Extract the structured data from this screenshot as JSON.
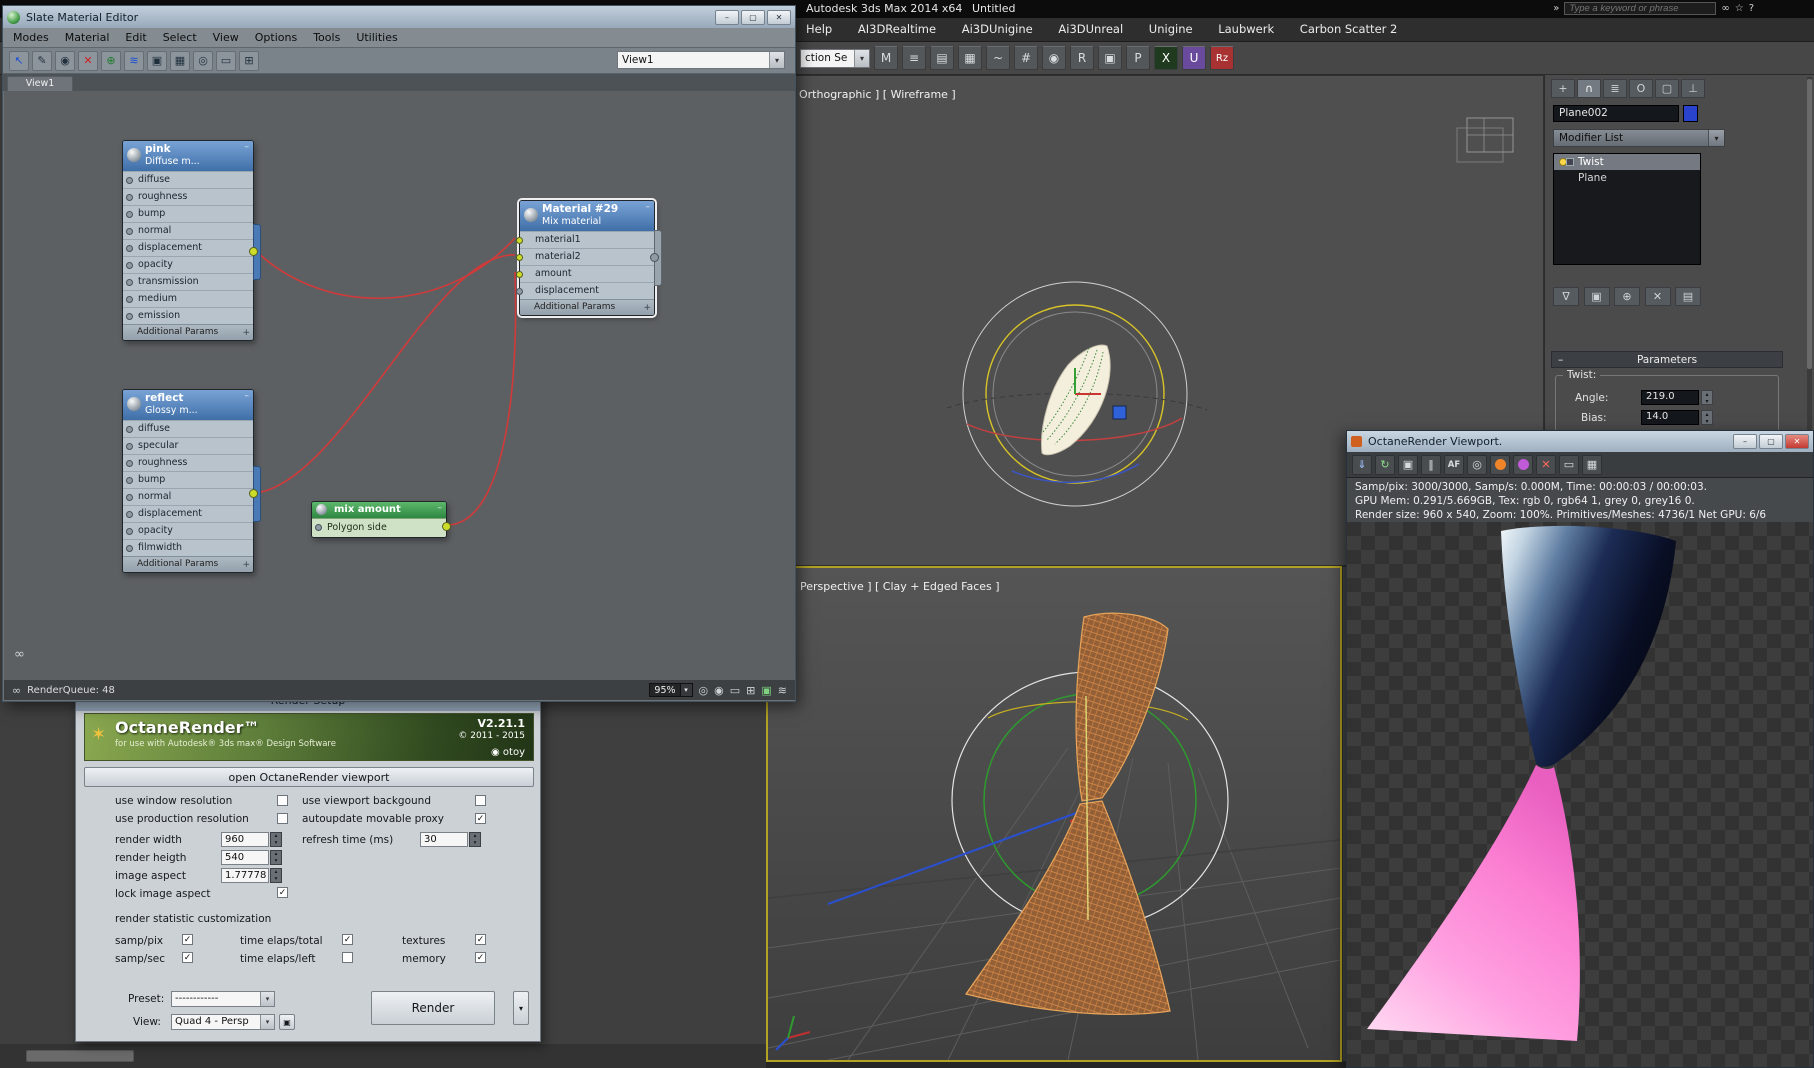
{
  "icons": {
    "min": "–",
    "max": "▢",
    "close": "✕",
    "check": "✓",
    "up": "▴",
    "down": "▾",
    "plus": "+",
    "chev": "»",
    "binoculars": "∞",
    "star": "☆",
    "help": "?",
    "select": "↖",
    "pick": "✎",
    "material": "◉",
    "delete": "✕",
    "add": "⊕",
    "wave": "≋",
    "shaded": "▣",
    "grid": "▦",
    "zoom": "◎",
    "region": "▭",
    "layout": "⊞",
    "mirror": "M",
    "align": "≡",
    "layers": "▤",
    "graphite": "▦",
    "curves": "~",
    "schematic": "#",
    "mateditor": "◉",
    "rsetup": "R",
    "frame": "▣",
    "teapot": "P",
    "plugx": "X",
    "plugu": "U",
    "plugrz": "Rz",
    "t1": "+",
    "t2": "∩",
    "t3": "≣",
    "t4": "O",
    "t5": "▢",
    "t6": "⊥",
    "b1": "∇",
    "b2": "▣",
    "b3": "⊕",
    "b4": "✕",
    "b5": "▤",
    "save": "⇓",
    "refresh": "↻",
    "lock": "▣",
    "pause": "‖",
    "af": "AF",
    "cam": "◎",
    "stop": "✕",
    "disp": "▭",
    "film": "▦"
  },
  "max": {
    "title": "Autodesk 3ds Max 2014 x64",
    "doc": "Untitled",
    "search_placeholder": "Type a keyword or phrase",
    "menus": [
      "Help",
      "AI3DRealtime",
      "Ai3DUnigine",
      "Ai3DUnreal",
      "Unigine",
      "Laubwerk",
      "Carbon Scatter 2"
    ],
    "selection_combo": "ction Se",
    "viewports": {
      "ortho_label": "Orthographic ] [ Wireframe ]",
      "persp_label": "Perspective ] [ Clay + Edged Faces ]"
    },
    "panel": {
      "object_name": "Plane002",
      "modifier_list": "Modifier List",
      "stack_twist": "Twist",
      "stack_plane": "Plane",
      "parameters": "Parameters",
      "twist_group": "Twist:",
      "angle_label": "Angle:",
      "angle_value": "219.0",
      "bias_label": "Bias:",
      "bias_value": "14.0"
    }
  },
  "slate": {
    "title": "Slate Material Editor",
    "menus": [
      "Modes",
      "Material",
      "Edit",
      "Select",
      "View",
      "Options",
      "Tools",
      "Utilities"
    ],
    "view_combo": "View1",
    "tab": "View1",
    "status": {
      "queue": "RenderQueue: 48",
      "zoom": "95%"
    },
    "nodes": {
      "pink": {
        "name": "pink",
        "type": "Diffuse m...",
        "slots": [
          "diffuse",
          "roughness",
          "bump",
          "normal",
          "displacement",
          "opacity",
          "transmission",
          "medium",
          "emission"
        ],
        "footer": "Additional Params"
      },
      "reflect": {
        "name": "reflect",
        "type": "Glossy m...",
        "slots": [
          "diffuse",
          "specular",
          "roughness",
          "bump",
          "normal",
          "displacement",
          "opacity",
          "filmwidth"
        ],
        "footer": "Additional Params"
      },
      "mix_material": {
        "name": "Material #29",
        "type": "Mix material",
        "slots": [
          "material1",
          "material2",
          "amount",
          "displacement"
        ],
        "footer": "Additional Params"
      },
      "mix_amount": {
        "name": "mix amount",
        "type": "Polygon side"
      }
    }
  },
  "render_setup": {
    "title": "Render Setup",
    "banner": {
      "brand": "OctaneRender™",
      "tagline": "for use with Autodesk® 3ds max® Design Software",
      "version": "V2.21.1",
      "copyright": "© 2011 - 2015",
      "otoy": "otoy"
    },
    "open_viewport_button": "open OctaneRender viewport",
    "options": {
      "use_window_resolution": "use window resolution",
      "use_viewport_background": "use viewport backgound",
      "use_production_resolution": "use production resolution",
      "autoupdate_movable_proxy": "autoupdate movable proxy",
      "render_width_label": "render width",
      "render_width": "960",
      "render_height_label": "render heigth",
      "render_height": "540",
      "image_aspect_label": "image aspect",
      "image_aspect": "1.77778",
      "lock_image_aspect": "lock image aspect",
      "refresh_time_label": "refresh time (ms)",
      "refresh_time": "30"
    },
    "stats_section": {
      "heading": "render statistic customization",
      "samp_pix": "samp/pix",
      "time_total": "time elaps/total",
      "textures": "textures",
      "samp_sec": "samp/sec",
      "time_left": "time elaps/left",
      "memory": "memory"
    },
    "footer": {
      "preset_label": "Preset:",
      "preset_value": "------------",
      "view_label": "View:",
      "view_value": "Quad 4 - Persp",
      "render_button": "Render"
    }
  },
  "octane": {
    "title": "OctaneRender Viewport.",
    "stats_line1": "Samp/pix: 3000/3000,  Samp/s: 0.000M,  Time: 00:00:03 / 00:00:03.",
    "stats_line2": "GPU Mem: 0.291/5.669GB,  Tex: rgb 0, rgb64 1, grey 0, grey16 0.",
    "stats_line3": "Render size: 960 x 540,  Zoom: 100%.  Primitives/Meshes: 4736/1  Net GPU: 6/6"
  }
}
